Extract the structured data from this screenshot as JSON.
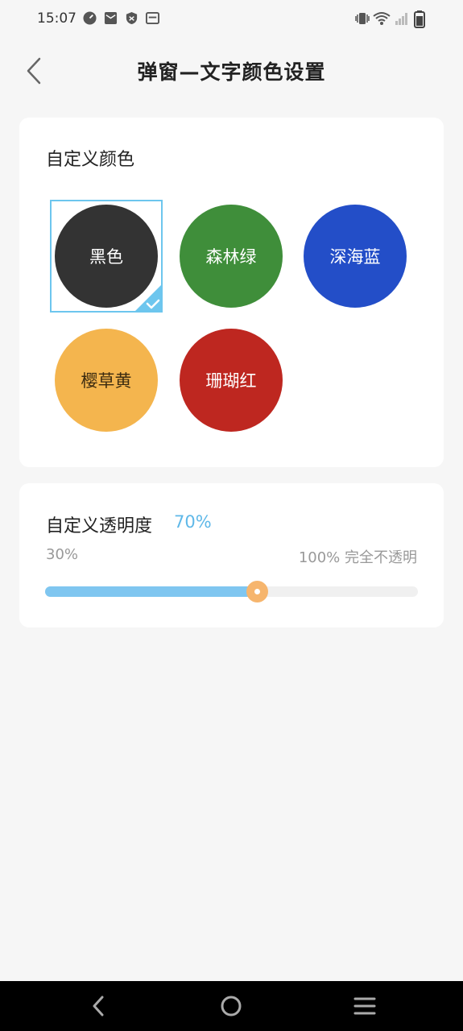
{
  "status_bar": {
    "time": "15:07"
  },
  "header": {
    "title": "弹窗—文字颜色设置"
  },
  "color_section": {
    "title": "自定义颜色",
    "colors": [
      {
        "label": "黑色",
        "color": "#333333",
        "selected": true
      },
      {
        "label": "森林绿",
        "color": "#3f8e3a",
        "selected": false
      },
      {
        "label": "深海蓝",
        "color": "#234ec8",
        "selected": false
      },
      {
        "label": "樱草黄",
        "color": "#f4b54e",
        "selected": false
      },
      {
        "label": "珊瑚红",
        "color": "#be2720",
        "selected": false
      }
    ]
  },
  "opacity_section": {
    "title": "自定义透明度",
    "value": "70%",
    "min_label": "30%",
    "max_label": "100% 完全不透明",
    "slider_fraction": 0.567
  },
  "colors": {
    "accent": "#5fb8e8",
    "slider_fill": "#7fc6f0",
    "thumb": "#f6b56d"
  }
}
